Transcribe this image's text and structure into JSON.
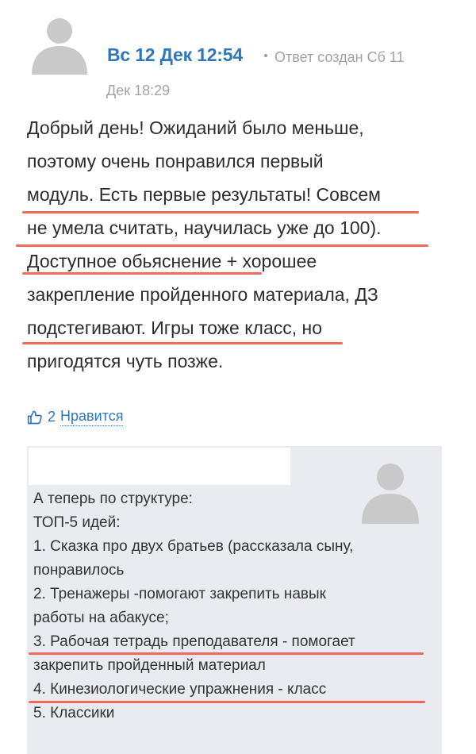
{
  "post": {
    "date": "Вс 12 Дек 12:54",
    "reply_info_part1": "Ответ создан Сб 11",
    "reply_info_part2": "Дек 18:29",
    "lines": [
      "Добрый день! Ожиданий было меньше,",
      "поэтому очень понравился первый",
      "модуль. Есть первые результаты! Совсем",
      "не умела считать, научилась уже до 100).",
      "Доступное обьяснение + хорошее",
      "закрепление пройденного материала, ДЗ",
      "подстегивают. Игры тоже класс, но",
      "пригодятся чуть позже."
    ]
  },
  "like": {
    "icon": "thumbs-up-icon",
    "count": "2",
    "label": "Нравится"
  },
  "comment": {
    "lines": [
      "А теперь по структуре:",
      "ТОП-5 идей:",
      "1. Сказка про двух братьев (рассказала сыну,",
      "понравилось",
      "2. Тренажеры -помогают закрепить навык",
      "работы на абакусе;",
      "3. Рабочая тетрадь преподавателя - помогает",
      "закрепить пройденный материал",
      "4. Кинезиологические упражнения - класс",
      "5. Классики"
    ]
  },
  "colors": {
    "link": "#2f77b8",
    "highlight_underline": "#ef6a5b",
    "comment_bg": "#e9ebf0"
  }
}
